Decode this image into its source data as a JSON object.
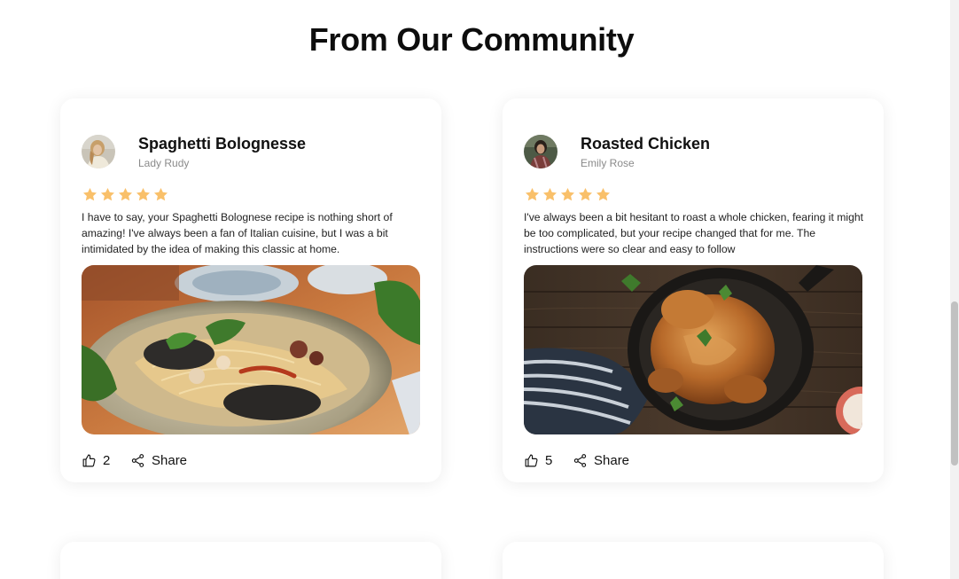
{
  "section": {
    "title": "From Our Community"
  },
  "posts": [
    {
      "title": "Spaghetti Bolognesse",
      "author": "Lady Rudy",
      "rating": 5,
      "review": "I have to say, your Spaghetti Bolognese recipe is nothing short of amazing! I've always been a fan of Italian cuisine, but I was a bit intimidated by the idea of making this classic at home.",
      "likes": "2",
      "share_label": "Share",
      "image": "spaghetti-photo"
    },
    {
      "title": "Roasted Chicken",
      "author": "Emily Rose",
      "rating": 5,
      "review": "I've always been a bit hesitant to roast a whole chicken, fearing it might be too complicated, but your recipe changed that for me. The instructions were so clear and easy to follow",
      "likes": "5",
      "share_label": "Share",
      "image": "roasted-chicken-photo"
    }
  ],
  "icons": {
    "like": "thumbs-up-icon",
    "share": "share-icon",
    "star": "star-icon"
  },
  "colors": {
    "star": "#f9c06a",
    "title": "#0d0d0d",
    "muted": "#8a8a8a"
  }
}
